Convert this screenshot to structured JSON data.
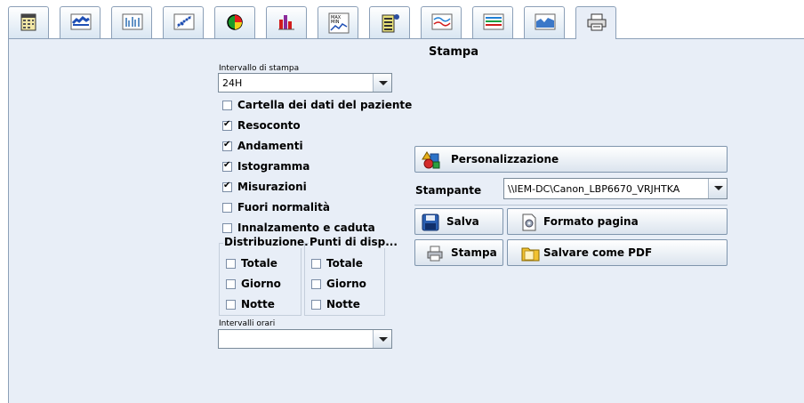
{
  "tabs": [
    {
      "icon": "calendar-icon"
    },
    {
      "icon": "trend-chart-icon"
    },
    {
      "icon": "bar-trend-icon"
    },
    {
      "icon": "scatter-plot-icon"
    },
    {
      "icon": "pie-chart-icon"
    },
    {
      "icon": "histogram-icon"
    },
    {
      "icon": "max-min-icon"
    },
    {
      "icon": "report-list-icon"
    },
    {
      "icon": "daily-curve-icon"
    },
    {
      "icon": "stacked-curve-icon"
    },
    {
      "icon": "area-curve-icon"
    },
    {
      "icon": "printer-icon"
    }
  ],
  "header": {
    "title": "Stampa"
  },
  "left": {
    "interval_label": "Intervallo di stampa",
    "interval_value": "24H",
    "checks": [
      {
        "label": "Cartella dei dati del paziente",
        "checked": false
      },
      {
        "label": "Resoconto",
        "checked": true
      },
      {
        "label": "Andamenti",
        "checked": true
      },
      {
        "label": "Istogramma",
        "checked": true
      },
      {
        "label": "Misurazioni",
        "checked": true
      },
      {
        "label": "Fuori normalità",
        "checked": false
      },
      {
        "label": "Innalzamento e caduta",
        "checked": false
      }
    ],
    "group1": {
      "title": "Distribuzione...",
      "items": [
        {
          "label": "Totale",
          "checked": false
        },
        {
          "label": "Giorno",
          "checked": false
        },
        {
          "label": "Notte",
          "checked": false
        }
      ]
    },
    "group2": {
      "title": "Punti di disp...",
      "items": [
        {
          "label": "Totale",
          "checked": false
        },
        {
          "label": "Giorno",
          "checked": false
        },
        {
          "label": "Notte",
          "checked": false
        }
      ]
    },
    "hours_label": "Intervalli orari",
    "hours_value": ""
  },
  "right": {
    "customize_label": "Personalizzazione",
    "printer_label": "Stampante",
    "printer_value": "\\\\IEM-DC\\Canon_LBP6670_VRJHTKA",
    "save_label": "Salva",
    "page_format_label": "Formato pagina",
    "print_label": "Stampa",
    "pdf_label": "Salvare come PDF"
  }
}
